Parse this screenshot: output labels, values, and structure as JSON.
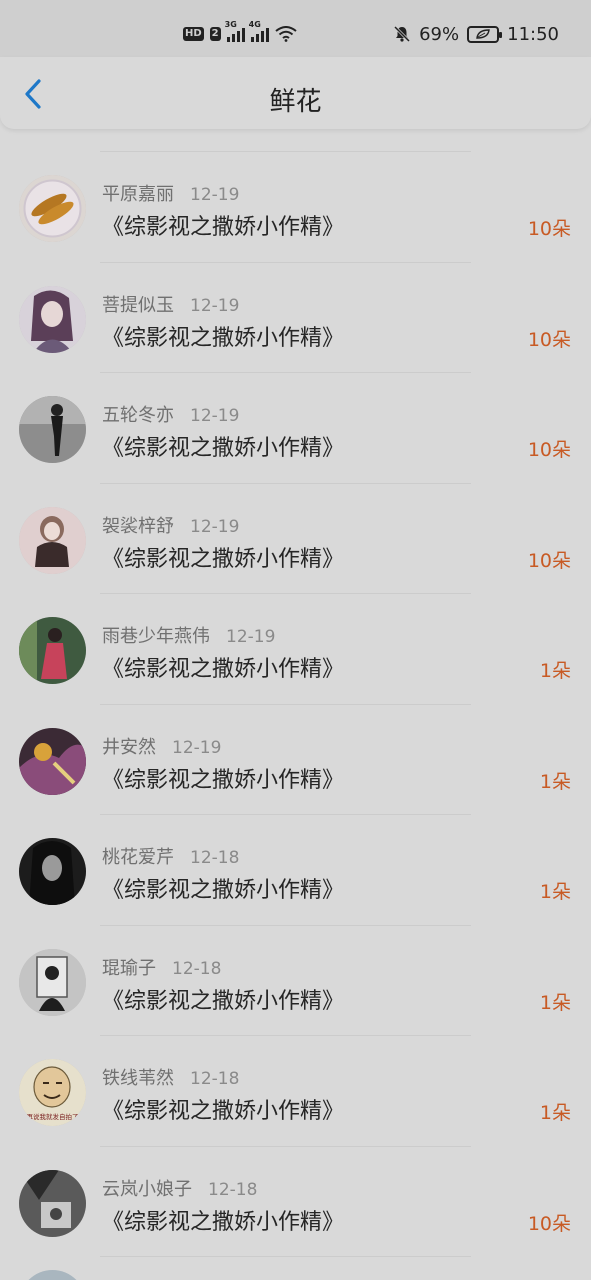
{
  "status_bar": {
    "network_badge": "HD",
    "sim_badge": "2",
    "signal1_label": "3G",
    "signal2_label": "4G",
    "battery": "69%",
    "time": "11:50"
  },
  "header": {
    "title": "鲜花",
    "back_icon": "chevron-left-icon"
  },
  "colors": {
    "accent_back": "#1e78c8",
    "amount": "#c85a24"
  },
  "items": [
    {
      "name": "平原嘉丽",
      "date": "12-19",
      "book": "《综影视之撒娇小作精》",
      "amount": "10朵"
    },
    {
      "name": "菩提似玉",
      "date": "12-19",
      "book": "《综影视之撒娇小作精》",
      "amount": "10朵"
    },
    {
      "name": "五轮冬亦",
      "date": "12-19",
      "book": "《综影视之撒娇小作精》",
      "amount": "10朵"
    },
    {
      "name": "袈裟梓舒",
      "date": "12-19",
      "book": "《综影视之撒娇小作精》",
      "amount": "10朵"
    },
    {
      "name": "雨巷少年燕伟",
      "date": "12-19",
      "book": "《综影视之撒娇小作精》",
      "amount": "1朵"
    },
    {
      "name": "井安然",
      "date": "12-19",
      "book": "《综影视之撒娇小作精》",
      "amount": "1朵"
    },
    {
      "name": "桃花爱芹",
      "date": "12-18",
      "book": "《综影视之撒娇小作精》",
      "amount": "1朵"
    },
    {
      "name": "琨瑜子",
      "date": "12-18",
      "book": "《综影视之撒娇小作精》",
      "amount": "1朵"
    },
    {
      "name": "铁线苇然",
      "date": "12-18",
      "book": "《综影视之撒娇小作精》",
      "amount": "1朵"
    },
    {
      "name": "云岚小娘子",
      "date": "12-18",
      "book": "《综影视之撒娇小作精》",
      "amount": "10朵"
    }
  ],
  "avatar_art": {
    "meme_caption": "再说我就发自拍了"
  }
}
